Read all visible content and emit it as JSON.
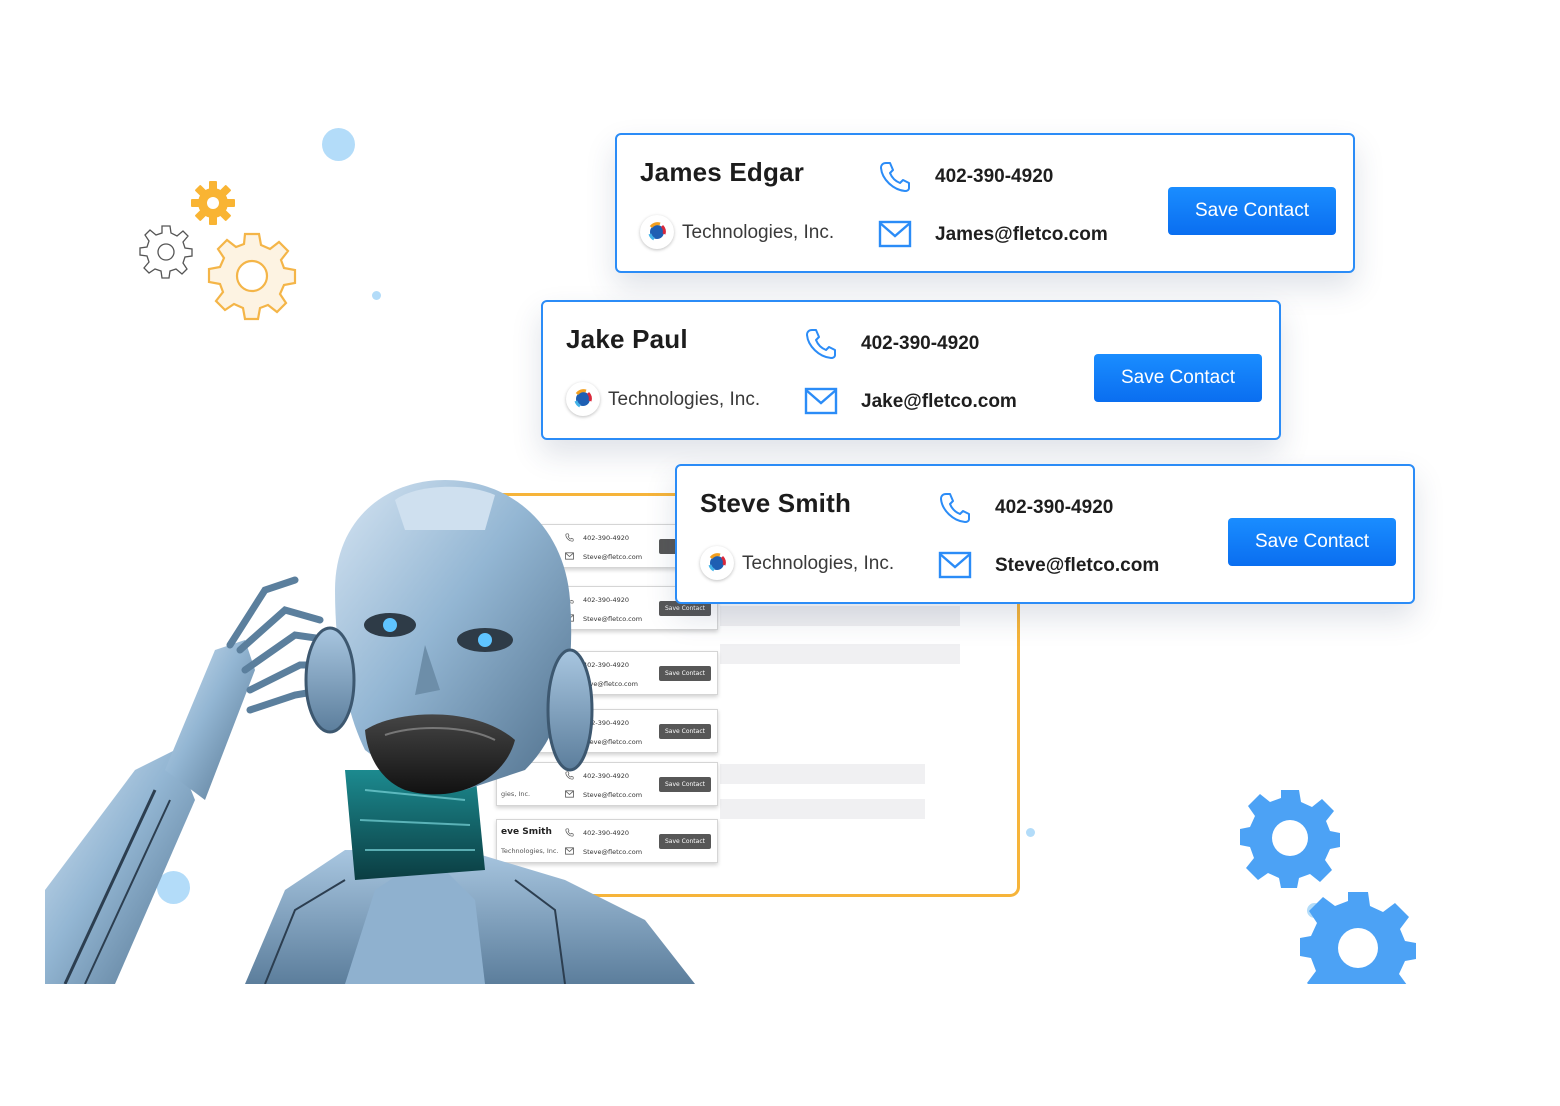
{
  "colors": {
    "accent": "#2b8cf7",
    "button": "#0a6ef0",
    "panel_border": "#f6b43a",
    "gear_orange": "#f9b433",
    "gear_blue": "#3d9bf6",
    "dot_blue": "#b3dcf9"
  },
  "contacts": [
    {
      "name": "James Edgar",
      "company": "Technologies, Inc.",
      "phone": "402-390-4920",
      "email": "James@fletco.com",
      "button": "Save Contact"
    },
    {
      "name": "Jake Paul",
      "company": "Technologies, Inc.",
      "phone": "402-390-4920",
      "email": "Jake@fletco.com",
      "button": "Save Contact"
    },
    {
      "name": "Steve Smith",
      "company": "Technologies, Inc.",
      "phone": "402-390-4920",
      "email": "Steve@fletco.com",
      "button": "Save Contact"
    }
  ],
  "mini_cards": [
    {
      "name": "",
      "company": "",
      "phone": "402-390-4920",
      "email": "Steve@fletco.com",
      "button": "Sa"
    },
    {
      "name": "",
      "company": "",
      "phone": "402-390-4920",
      "email": "Steve@fletco.com",
      "button": "Save Contact"
    },
    {
      "name": "",
      "company": "",
      "phone": "402-390-4920",
      "email": "teve@fletco.com",
      "button": "Save Contact"
    },
    {
      "name": "",
      "company": "",
      "phone": "402-390-4920",
      "email": "Steve@fletco.com",
      "button": "Save Contact"
    },
    {
      "name": "",
      "company": "gies, Inc.",
      "phone": "402-390-4920",
      "email": "Steve@fletco.com",
      "button": "Save Contact"
    },
    {
      "name": "eve Smith",
      "company": "Technologies, Inc.",
      "phone": "402-390-4920",
      "email": "Steve@fletco.com",
      "button": "Save Contact"
    }
  ],
  "icons": {
    "phone": "phone-icon",
    "mail": "mail-icon",
    "logo": "company-logo-icon",
    "gear": "gear-icon",
    "robot": "robot-illustration"
  }
}
